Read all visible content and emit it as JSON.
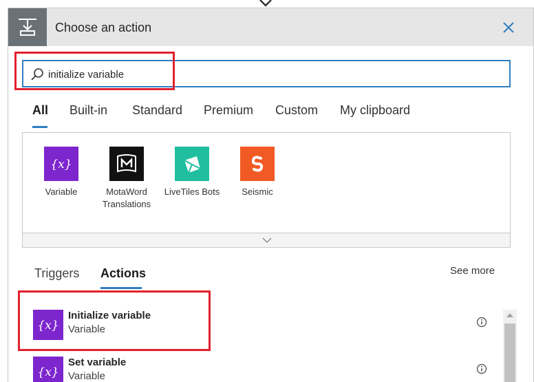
{
  "header": {
    "title": "Choose an action"
  },
  "search": {
    "value": "initialize variable",
    "placeholder": ""
  },
  "tabs": [
    {
      "label": "All",
      "active": true
    },
    {
      "label": "Built-in"
    },
    {
      "label": "Standard"
    },
    {
      "label": "Premium"
    },
    {
      "label": "Custom"
    },
    {
      "label": "My clipboard"
    }
  ],
  "connectors": [
    {
      "name": "Variable",
      "icon": "variable-icon",
      "color": "#7d26cd"
    },
    {
      "name": "MotaWord Translations",
      "icon": "motaword-icon",
      "color": "#111111"
    },
    {
      "name": "LiveTiles Bots",
      "icon": "livetiles-icon",
      "color": "#1fbf9f"
    },
    {
      "name": "Seismic",
      "icon": "seismic-icon",
      "color": "#f15a24"
    }
  ],
  "sub_tabs": {
    "triggers": "Triggers",
    "actions": "Actions",
    "see_more": "See more"
  },
  "actions": [
    {
      "name": "Initialize variable",
      "connector": "Variable"
    },
    {
      "name": "Set variable",
      "connector": "Variable"
    }
  ],
  "colors": {
    "accent": "#2f7ec4",
    "highlight": "#e0222c",
    "variable": "#7d26cd"
  }
}
